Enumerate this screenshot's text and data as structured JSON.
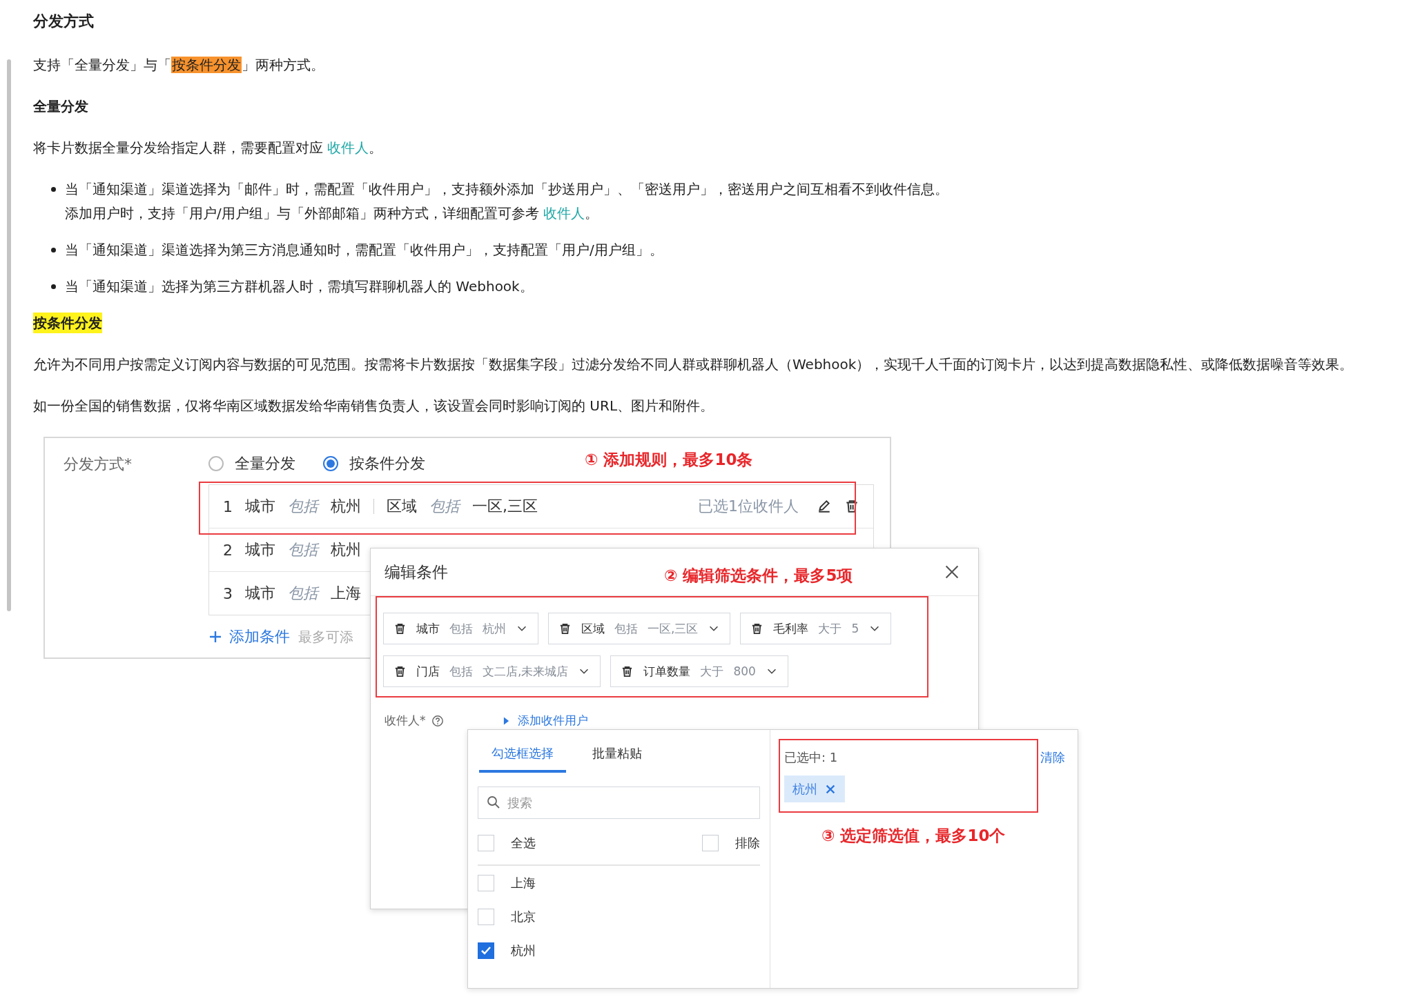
{
  "doc": [
    {
      "kind": "heading",
      "text": "分发方式"
    },
    {
      "kind": "paragraph",
      "parts": [
        {
          "text": "支持「全量分发」与「"
        },
        {
          "text": "按条件分发",
          "kind": "mark",
          "color": "#f7922d"
        },
        {
          "text": "」两种方式。"
        }
      ]
    },
    {
      "kind": "subheading",
      "text": "全量分发"
    },
    {
      "kind": "paragraph",
      "parts": [
        {
          "text": "将卡片数据全量分发给指定人群，需要配置对应 "
        },
        {
          "text": "收件人",
          "kind": "link"
        },
        {
          "text": "。"
        }
      ]
    },
    {
      "kind": "list",
      "items": [
        {
          "lines": [
            [
              {
                "text": "当「通知渠道」渠道选择为「邮件」时，需配置「收件用户」，支持额外添加「抄送用户」、「密送用户」，密送用户之间互相看不到收件信息。"
              }
            ],
            [
              {
                "text": "添加用户时，支持「用户/用户组」与「外部邮箱」两种方式，详细配置可参考 "
              },
              {
                "text": "收件人",
                "kind": "link"
              },
              {
                "text": "。"
              }
            ]
          ]
        },
        {
          "lines": [
            [
              {
                "text": "当「通知渠道」渠道选择为第三方消息通知时，需配置「收件用户」，支持配置「用户/用户组」。"
              }
            ]
          ]
        },
        {
          "lines": [
            [
              {
                "text": "当「通知渠道」选择为第三方群机器人时，需填写群聊机器人的 Webhook。"
              }
            ]
          ]
        }
      ]
    },
    {
      "kind": "subheading",
      "text": "按条件分发",
      "color": "#fff31c"
    },
    {
      "kind": "paragraph",
      "parts": [
        {
          "text": "允许为不同用户按需定义订阅内容与数据的可见范围。按需将卡片数据按「数据集字段」过滤分发给不同人群或群聊机器人（Webhook），实现千人千面的订阅卡片，以达到提高数据隐私性、或降低数据噪音等效果。"
        }
      ]
    },
    {
      "kind": "paragraph",
      "parts": [
        {
          "text": "如一份全国的销售数据，仅将华南区域数据发给华南销售负责人，该设置会同时影响订阅的 URL、图片和附件。"
        }
      ]
    }
  ],
  "form": {
    "label": "分发方式*",
    "options": [
      {
        "label": "全量分发",
        "selected": false
      },
      {
        "label": "按条件分发",
        "selected": true
      }
    ],
    "rules": [
      {
        "index": "1",
        "conditions": [
          {
            "field": "城市",
            "op": "包括",
            "value": "杭州"
          },
          {
            "field": "区域",
            "op": "包括",
            "value": "一区,三区"
          }
        ],
        "recipients": "已选1位收件人"
      },
      {
        "index": "2",
        "conditions": [
          {
            "field": "城市",
            "op": "包括",
            "value": "杭州"
          }
        ]
      },
      {
        "index": "3",
        "conditions": [
          {
            "field": "城市",
            "op": "包括",
            "value": "上海"
          }
        ]
      }
    ],
    "add_label": "添加条件",
    "add_hint": "最多可添"
  },
  "dialog": {
    "title": "编辑条件",
    "conditions": [
      {
        "field": "城市",
        "op": "包括",
        "value": "杭州"
      },
      {
        "field": "区域",
        "op": "包括",
        "value": "一区,三区"
      },
      {
        "field": "毛利率",
        "op": "大于",
        "value": "5"
      },
      {
        "field": "门店",
        "op": "包括",
        "value": "文二店,未来城店"
      },
      {
        "field": "订单数量",
        "op": "大于",
        "value": "800"
      }
    ],
    "recipient_label": "收件人*",
    "add_recipient": "添加收件用户"
  },
  "picker": {
    "tabs": [
      {
        "label": "勾选框选择",
        "selected": true
      },
      {
        "label": "批量粘贴",
        "selected": false
      }
    ],
    "search": {
      "placeholder": "搜索"
    },
    "select_all": {
      "label": "全选",
      "checked": false
    },
    "exclude": {
      "label": "排除",
      "checked": false
    },
    "options": [
      {
        "label": "上海",
        "checked": false
      },
      {
        "label": "北京",
        "checked": false
      },
      {
        "label": "杭州",
        "checked": true
      }
    ],
    "selected_count": "已选中: 1",
    "clear": "清除",
    "chips": [
      "杭州"
    ]
  },
  "annotations": [
    "① 添加规则，最多10条",
    "② 编辑筛选条件，最多5项",
    "③ 选定筛选值，最多10个"
  ]
}
